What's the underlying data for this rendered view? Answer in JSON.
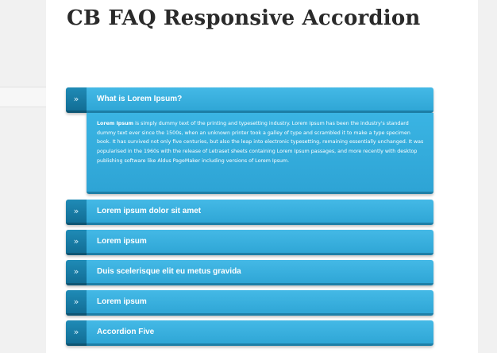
{
  "page": {
    "title": "CB FAQ Responsive Accordion"
  },
  "accordion": {
    "toggle_glyph": "»",
    "items": [
      {
        "title": "What is Lorem Ipsum?",
        "expanded": true,
        "content_lead": "Lorem Ipsum",
        "content_rest": " is simply dummy text of the printing and typesetting industry. Lorem Ipsum has been the industry's standard dummy text ever since the 1500s, when an unknown printer took a galley of type and scrambled it to make a type specimen book. It has survived not only five centuries, but also the leap into electronic typesetting, remaining essentially unchanged. It was popularised in the 1960s with the release of Letraset sheets containing Lorem Ipsum passages, and more recently with desktop publishing software like Aldus PageMaker including versions of Lorem Ipsum."
      },
      {
        "title": "Lorem ipsum dolor sit amet",
        "expanded": false
      },
      {
        "title": "Lorem ipsum",
        "expanded": false
      },
      {
        "title": "Duis scelerisque elit eu metus gravida",
        "expanded": false
      },
      {
        "title": "Lorem ipsum",
        "expanded": false
      },
      {
        "title": "Accordion Five",
        "expanded": false
      }
    ]
  },
  "colors": {
    "accent": "#3ab4e3",
    "accent_dark": "#126e95",
    "title_text": "#2a2a2a"
  }
}
